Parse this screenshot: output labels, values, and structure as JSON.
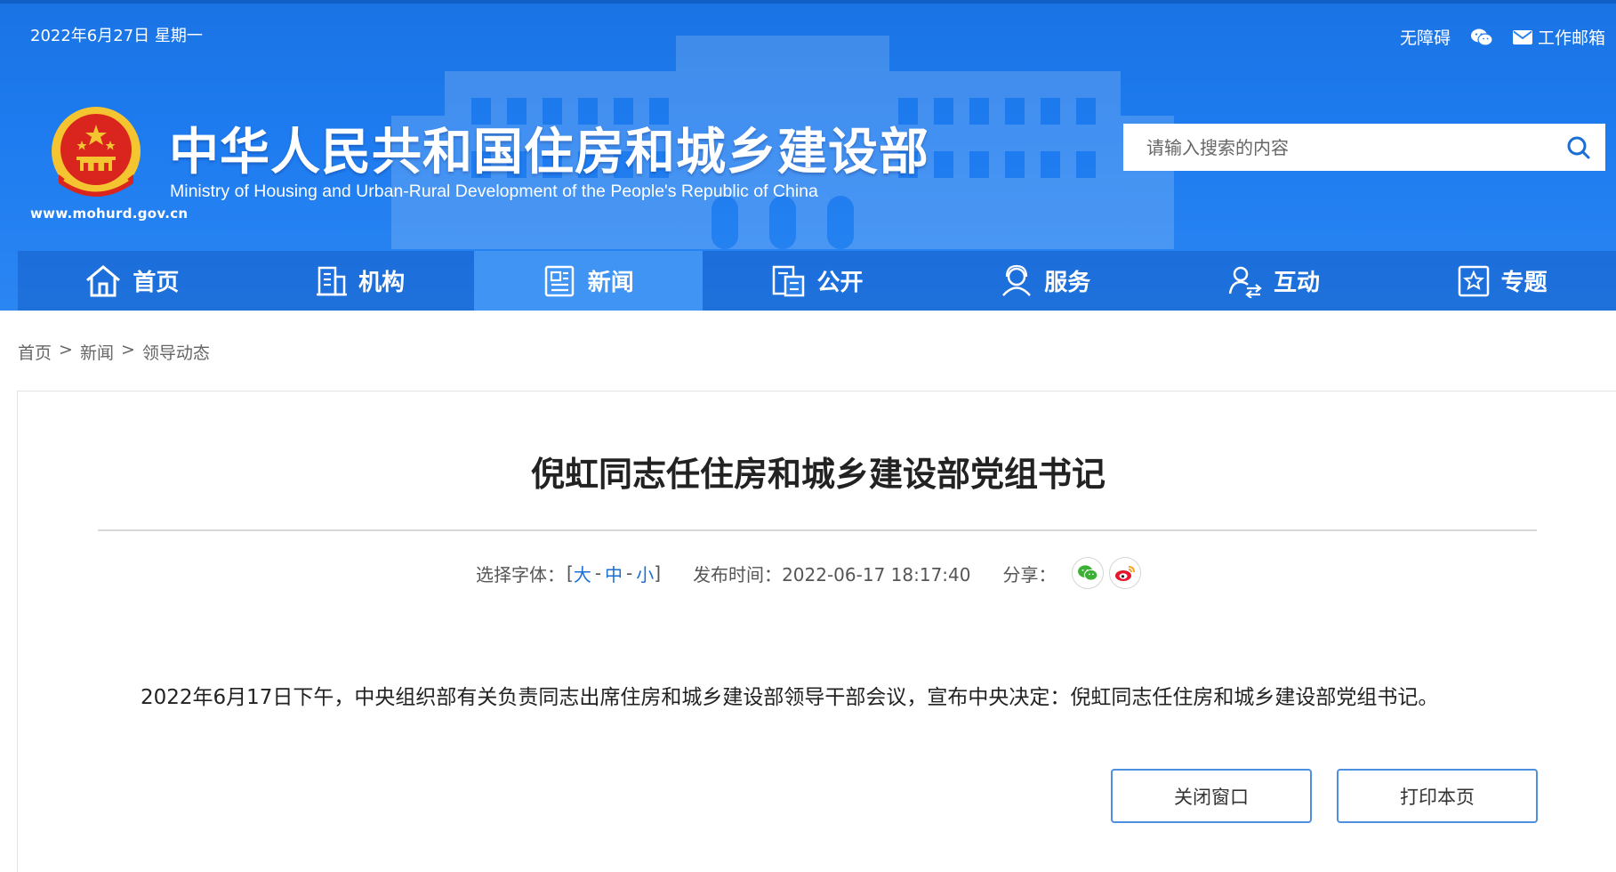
{
  "header": {
    "date": "2022年6月27日 星期一",
    "top_links": {
      "accessibility": "无障碍",
      "wechat_icon": "wechat-icon",
      "mail_icon": "mail-icon",
      "work_mail": "工作邮箱"
    },
    "title_cn": "中华人民共和国住房和城乡建设部",
    "title_en": "Ministry of Housing and Urban-Rural Development of the People's Republic of China",
    "site_url": "www.mohurd.gov.cn",
    "search": {
      "placeholder": "请输入搜索的内容"
    }
  },
  "nav": {
    "items": [
      {
        "label": "首页",
        "icon": "home-icon"
      },
      {
        "label": "机构",
        "icon": "building-icon"
      },
      {
        "label": "新闻",
        "icon": "news-icon",
        "active": true
      },
      {
        "label": "公开",
        "icon": "document-icon"
      },
      {
        "label": "服务",
        "icon": "service-icon"
      },
      {
        "label": "互动",
        "icon": "interaction-icon"
      },
      {
        "label": "专题",
        "icon": "star-icon"
      }
    ]
  },
  "breadcrumb": {
    "items": [
      "首页",
      "新闻",
      "领导动态"
    ],
    "separator": ">"
  },
  "article": {
    "title": "倪虹同志任住房和城乡建设部党组书记",
    "font_size_label": "选择字体：",
    "font_sizes": [
      "大",
      "中",
      "小"
    ],
    "publish_label": "发布时间：",
    "publish_time": "2022-06-17 18:17:40",
    "share_label": "分享：",
    "body": "2022年6月17日下午，中央组织部有关负责同志出席住房和城乡建设部领导干部会议，宣布中央决定：倪虹同志任住房和城乡建设部党组书记。",
    "close_button": "关闭窗口",
    "print_button": "打印本页"
  },
  "colors": {
    "header_blue": "#1e7cf0",
    "nav_active": "#3f94f4",
    "link_blue": "#1a6fd6",
    "button_border": "#4e8fdf"
  }
}
